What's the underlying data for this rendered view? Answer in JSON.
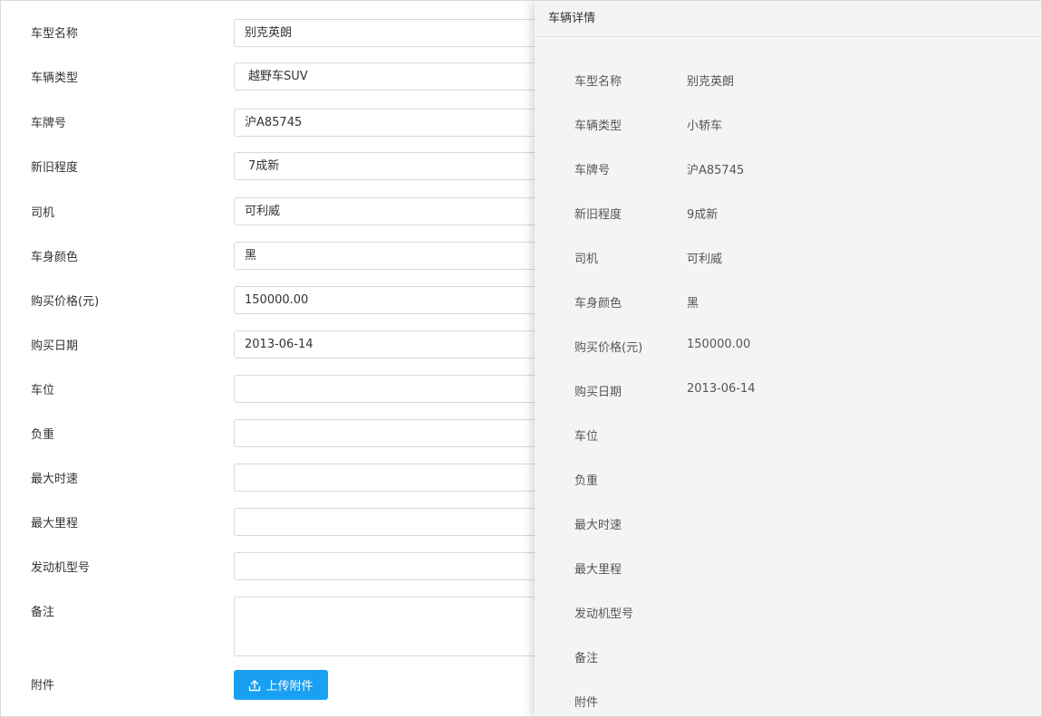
{
  "form": {
    "fields": [
      {
        "label": "车型名称",
        "value": "别克英朗",
        "type": "input"
      },
      {
        "label": "车辆类型",
        "value": "越野车SUV",
        "type": "select"
      },
      {
        "label": "车牌号",
        "value": "沪A85745",
        "type": "input"
      },
      {
        "label": "新旧程度",
        "value": "7成新",
        "type": "select"
      },
      {
        "label": "司机",
        "value": "可利威",
        "type": "input"
      },
      {
        "label": "车身颜色",
        "value": "黑",
        "type": "input"
      },
      {
        "label": "购买价格(元)",
        "value": "150000.00",
        "type": "input"
      },
      {
        "label": "购买日期",
        "value": "2013-06-14",
        "type": "input"
      },
      {
        "label": "车位",
        "value": "",
        "type": "input"
      },
      {
        "label": "负重",
        "value": "",
        "type": "input"
      },
      {
        "label": "最大时速",
        "value": "",
        "type": "input"
      },
      {
        "label": "最大里程",
        "value": "",
        "type": "input"
      },
      {
        "label": "发动机型号",
        "value": "",
        "type": "input"
      }
    ],
    "remark_label": "备注",
    "attachment_label": "附件",
    "upload_button": "上传附件",
    "upload_icon": "upload-icon",
    "accent_color": "#1aa0f2"
  },
  "drawer": {
    "title": "车辆详情",
    "rows": [
      {
        "label": "车型名称",
        "value": "别克英朗"
      },
      {
        "label": "车辆类型",
        "value": "小轿车"
      },
      {
        "label": "车牌号",
        "value": "沪A85745"
      },
      {
        "label": "新旧程度",
        "value": "9成新"
      },
      {
        "label": "司机",
        "value": "可利威"
      },
      {
        "label": "车身颜色",
        "value": "黑"
      },
      {
        "label": "购买价格(元)",
        "value": "150000.00"
      },
      {
        "label": "购买日期",
        "value": "2013-06-14"
      },
      {
        "label": "车位",
        "value": ""
      },
      {
        "label": "负重",
        "value": ""
      },
      {
        "label": "最大时速",
        "value": ""
      },
      {
        "label": "最大里程",
        "value": ""
      },
      {
        "label": "发动机型号",
        "value": ""
      },
      {
        "label": "备注",
        "value": ""
      },
      {
        "label": "附件",
        "value": ""
      }
    ]
  }
}
